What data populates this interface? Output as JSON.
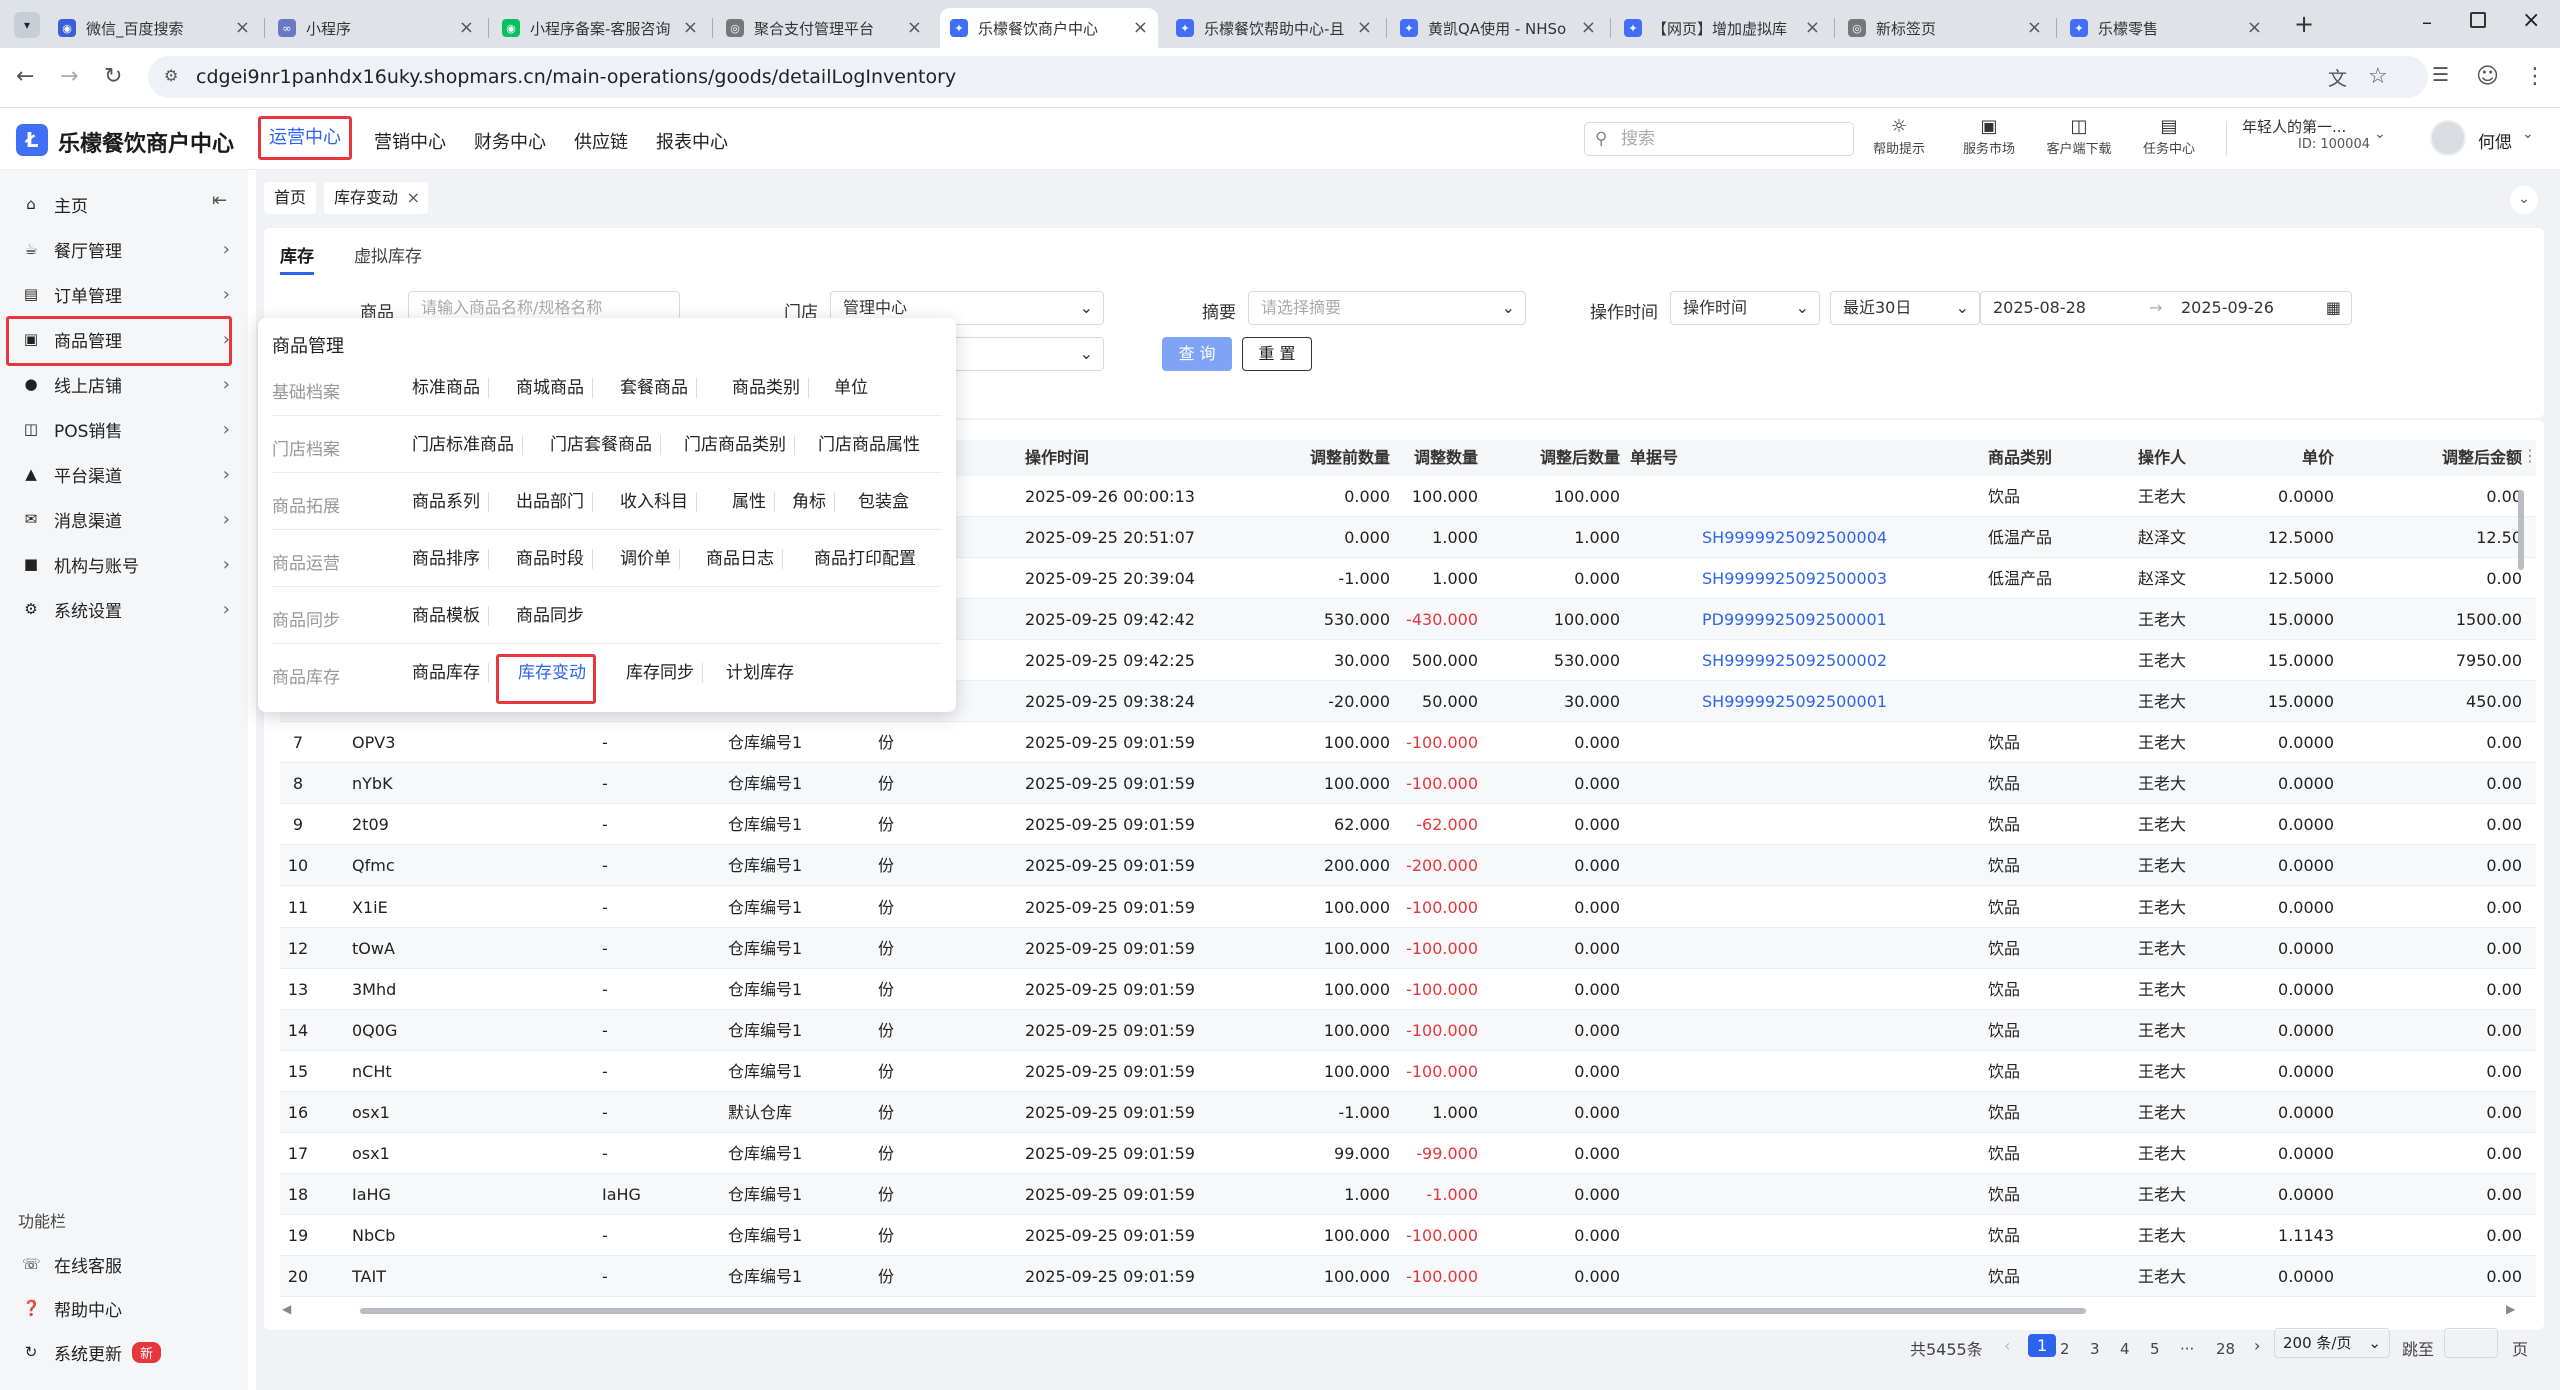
{
  "browser": {
    "tabs": [
      {
        "title": "微信_百度搜索",
        "icon": "baidu-icon"
      },
      {
        "title": "小程序",
        "icon": "link-icon"
      },
      {
        "title": "小程序备案-客服咨询",
        "icon": "wechat-icon"
      },
      {
        "title": "聚合支付管理平台",
        "icon": "globe-icon"
      },
      {
        "title": "乐檬餐饮商户中心",
        "icon": "lemon-icon"
      },
      {
        "title": "乐檬餐饮帮助中心-且",
        "icon": "lemon-icon"
      },
      {
        "title": "黄凯QA使用 - NHSo",
        "icon": "app-icon"
      },
      {
        "title": "【网页】增加虚拟库",
        "icon": "lemon-icon"
      },
      {
        "title": "新标签页",
        "icon": "globe-icon"
      },
      {
        "title": "乐檬零售",
        "icon": "lemon-icon"
      }
    ],
    "url": "cdgei9nr1panhdx16uky.shopmars.cn/main-operations/goods/detailLogInventory"
  },
  "header": {
    "brand": "乐檬餐饮商户中心",
    "nav": [
      "运营中心",
      "营销中心",
      "财务中心",
      "供应链",
      "报表中心"
    ],
    "search_placeholder": "搜索",
    "tools": [
      "帮助提示",
      "服务市场",
      "客户端下载",
      "任务中心"
    ],
    "org_name": "年轻人的第一...",
    "org_id": "ID: 100004",
    "user": "何偲"
  },
  "sidebar": {
    "items": [
      "主页",
      "餐厅管理",
      "订单管理",
      "商品管理",
      "线上店铺",
      "POS销售",
      "平台渠道",
      "消息渠道",
      "机构与账号",
      "系统设置"
    ],
    "footer_title": "功能栏",
    "footer": [
      "在线客服",
      "帮助中心",
      "系统更新"
    ],
    "new_badge": "新"
  },
  "breadcrumb": {
    "home": "首页",
    "current": "库存变动"
  },
  "tabs": [
    "库存",
    "虚拟库存"
  ],
  "filters": {
    "goods_label": "商品",
    "goods_placeholder": "请输入商品名称/规格名称",
    "store_label": "门店",
    "store_value": "管理中心",
    "summary_label": "摘要",
    "summary_placeholder": "请选择摘要",
    "optime_label": "操作时间",
    "optime_select": "操作时间",
    "range_select": "最近30日",
    "date_from": "2025-08-28",
    "date_to": "2025-09-26",
    "query": "查 询",
    "reset": "重 置"
  },
  "popup": {
    "title": "商品管理",
    "rows": [
      {
        "cat": "基础档案",
        "items": [
          "标准商品",
          "商城商品",
          "套餐商品",
          "商品类别",
          "单位"
        ]
      },
      {
        "cat": "门店档案",
        "items": [
          "门店标准商品",
          "门店套餐商品",
          "门店商品类别",
          "门店商品属性"
        ]
      },
      {
        "cat": "商品拓展",
        "items": [
          "商品系列",
          "出品部门",
          "收入科目",
          "属性",
          "角标",
          "包装盒"
        ]
      },
      {
        "cat": "商品运营",
        "items": [
          "商品排序",
          "商品时段",
          "调价单",
          "商品日志",
          "商品打印配置"
        ]
      },
      {
        "cat": "商品同步",
        "items": [
          "商品模板",
          "商品同步"
        ]
      },
      {
        "cat": "商品库存",
        "items": [
          "商品库存",
          "库存变动",
          "库存同步",
          "计划库存"
        ]
      }
    ]
  },
  "table": {
    "headers": [
      "操作时间",
      "调整前数量",
      "调整数量",
      "调整后数量",
      "单据号",
      "商品类别",
      "操作人",
      "单价",
      "调整后金额"
    ],
    "rows": [
      {
        "no": "",
        "name": "",
        "spec": "",
        "wh": "",
        "unit": "",
        "time": "2025-09-26 00:00:13",
        "before": "0.000",
        "adj": "100.000",
        "after": "100.000",
        "doc": "",
        "cat": "饮品",
        "op": "王老大",
        "price": "0.0000",
        "amount": "0.00"
      },
      {
        "no": "",
        "name": "",
        "spec": "",
        "wh": "",
        "unit": "",
        "time": "2025-09-25 20:51:07",
        "before": "0.000",
        "adj": "1.000",
        "after": "1.000",
        "doc": "SH9999925092500004",
        "cat": "低温产品",
        "op": "赵泽文",
        "price": "12.5000",
        "amount": "12.50"
      },
      {
        "no": "",
        "name": "",
        "spec": "",
        "wh": "",
        "unit": "",
        "time": "2025-09-25 20:39:04",
        "before": "-1.000",
        "adj": "1.000",
        "after": "0.000",
        "doc": "SH9999925092500003",
        "cat": "低温产品",
        "op": "赵泽文",
        "price": "12.5000",
        "amount": "0.00"
      },
      {
        "no": "",
        "name": "",
        "spec": "",
        "wh": "",
        "unit": "",
        "time": "2025-09-25 09:42:42",
        "before": "530.000",
        "adj": "-430.000",
        "after": "100.000",
        "doc": "PD9999925092500001",
        "cat": "",
        "op": "王老大",
        "price": "15.0000",
        "amount": "1500.00"
      },
      {
        "no": "",
        "name": "",
        "spec": "",
        "wh": "",
        "unit": "",
        "time": "2025-09-25 09:42:25",
        "before": "30.000",
        "adj": "500.000",
        "after": "530.000",
        "doc": "SH9999925092500002",
        "cat": "",
        "op": "王老大",
        "price": "15.0000",
        "amount": "7950.00"
      },
      {
        "no": "",
        "name": "",
        "spec": "",
        "wh": "",
        "unit": "",
        "time": "2025-09-25 09:38:24",
        "before": "-20.000",
        "adj": "50.000",
        "after": "30.000",
        "doc": "SH9999925092500001",
        "cat": "",
        "op": "王老大",
        "price": "15.0000",
        "amount": "450.00"
      },
      {
        "no": "7",
        "name": "OPV3",
        "spec": "-",
        "wh": "仓库编号1",
        "unit": "份",
        "time": "2025-09-25 09:01:59",
        "before": "100.000",
        "adj": "-100.000",
        "after": "0.000",
        "doc": "",
        "cat": "饮品",
        "op": "王老大",
        "price": "0.0000",
        "amount": "0.00"
      },
      {
        "no": "8",
        "name": "nYbK",
        "spec": "-",
        "wh": "仓库编号1",
        "unit": "份",
        "time": "2025-09-25 09:01:59",
        "before": "100.000",
        "adj": "-100.000",
        "after": "0.000",
        "doc": "",
        "cat": "饮品",
        "op": "王老大",
        "price": "0.0000",
        "amount": "0.00"
      },
      {
        "no": "9",
        "name": "2t09",
        "spec": "-",
        "wh": "仓库编号1",
        "unit": "份",
        "time": "2025-09-25 09:01:59",
        "before": "62.000",
        "adj": "-62.000",
        "after": "0.000",
        "doc": "",
        "cat": "饮品",
        "op": "王老大",
        "price": "0.0000",
        "amount": "0.00"
      },
      {
        "no": "10",
        "name": "Qfmc",
        "spec": "-",
        "wh": "仓库编号1",
        "unit": "份",
        "time": "2025-09-25 09:01:59",
        "before": "200.000",
        "adj": "-200.000",
        "after": "0.000",
        "doc": "",
        "cat": "饮品",
        "op": "王老大",
        "price": "0.0000",
        "amount": "0.00"
      },
      {
        "no": "11",
        "name": "X1iE",
        "spec": "-",
        "wh": "仓库编号1",
        "unit": "份",
        "time": "2025-09-25 09:01:59",
        "before": "100.000",
        "adj": "-100.000",
        "after": "0.000",
        "doc": "",
        "cat": "饮品",
        "op": "王老大",
        "price": "0.0000",
        "amount": "0.00"
      },
      {
        "no": "12",
        "name": "tOwA",
        "spec": "-",
        "wh": "仓库编号1",
        "unit": "份",
        "time": "2025-09-25 09:01:59",
        "before": "100.000",
        "adj": "-100.000",
        "after": "0.000",
        "doc": "",
        "cat": "饮品",
        "op": "王老大",
        "price": "0.0000",
        "amount": "0.00"
      },
      {
        "no": "13",
        "name": "3Mhd",
        "spec": "-",
        "wh": "仓库编号1",
        "unit": "份",
        "time": "2025-09-25 09:01:59",
        "before": "100.000",
        "adj": "-100.000",
        "after": "0.000",
        "doc": "",
        "cat": "饮品",
        "op": "王老大",
        "price": "0.0000",
        "amount": "0.00"
      },
      {
        "no": "14",
        "name": "0Q0G",
        "spec": "-",
        "wh": "仓库编号1",
        "unit": "份",
        "time": "2025-09-25 09:01:59",
        "before": "100.000",
        "adj": "-100.000",
        "after": "0.000",
        "doc": "",
        "cat": "饮品",
        "op": "王老大",
        "price": "0.0000",
        "amount": "0.00"
      },
      {
        "no": "15",
        "name": "nCHt",
        "spec": "-",
        "wh": "仓库编号1",
        "unit": "份",
        "time": "2025-09-25 09:01:59",
        "before": "100.000",
        "adj": "-100.000",
        "after": "0.000",
        "doc": "",
        "cat": "饮品",
        "op": "王老大",
        "price": "0.0000",
        "amount": "0.00"
      },
      {
        "no": "16",
        "name": "osx1",
        "spec": "-",
        "wh": "默认仓库",
        "unit": "份",
        "time": "2025-09-25 09:01:59",
        "before": "-1.000",
        "adj": "1.000",
        "after": "0.000",
        "doc": "",
        "cat": "饮品",
        "op": "王老大",
        "price": "0.0000",
        "amount": "0.00"
      },
      {
        "no": "17",
        "name": "osx1",
        "spec": "-",
        "wh": "仓库编号1",
        "unit": "份",
        "time": "2025-09-25 09:01:59",
        "before": "99.000",
        "adj": "-99.000",
        "after": "0.000",
        "doc": "",
        "cat": "饮品",
        "op": "王老大",
        "price": "0.0000",
        "amount": "0.00"
      },
      {
        "no": "18",
        "name": "IaHG",
        "spec": "IaHG",
        "wh": "仓库编号1",
        "unit": "份",
        "time": "2025-09-25 09:01:59",
        "before": "1.000",
        "adj": "-1.000",
        "after": "0.000",
        "doc": "",
        "cat": "饮品",
        "op": "王老大",
        "price": "0.0000",
        "amount": "0.00"
      },
      {
        "no": "19",
        "name": "NbCb",
        "spec": "-",
        "wh": "仓库编号1",
        "unit": "份",
        "time": "2025-09-25 09:01:59",
        "before": "100.000",
        "adj": "-100.000",
        "after": "0.000",
        "doc": "",
        "cat": "饮品",
        "op": "王老大",
        "price": "1.1143",
        "amount": "0.00"
      },
      {
        "no": "20",
        "name": "TAIT",
        "spec": "-",
        "wh": "仓库编号1",
        "unit": "份",
        "time": "2025-09-25 09:01:59",
        "before": "100.000",
        "adj": "-100.000",
        "after": "0.000",
        "doc": "",
        "cat": "饮品",
        "op": "王老大",
        "price": "0.0000",
        "amount": "0.00"
      }
    ]
  },
  "pagination": {
    "total": "共5455条",
    "pages": [
      "1",
      "2",
      "3",
      "4",
      "5",
      "···",
      "28"
    ],
    "page_size": "200 条/页",
    "goto": "跳至",
    "page_unit": "页"
  },
  "colors": {
    "accent": "#2d64ee",
    "danger": "#e8363c",
    "brand": "#3f6ff5"
  }
}
